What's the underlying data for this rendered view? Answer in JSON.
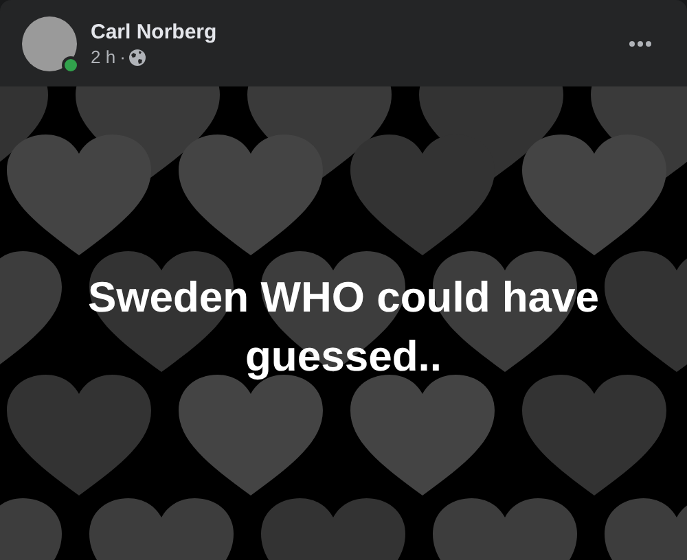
{
  "author": {
    "name": "Carl Norberg",
    "online": true
  },
  "post": {
    "time": "2 h",
    "separator": "·",
    "text": "Sweden WHO could have guessed.."
  }
}
